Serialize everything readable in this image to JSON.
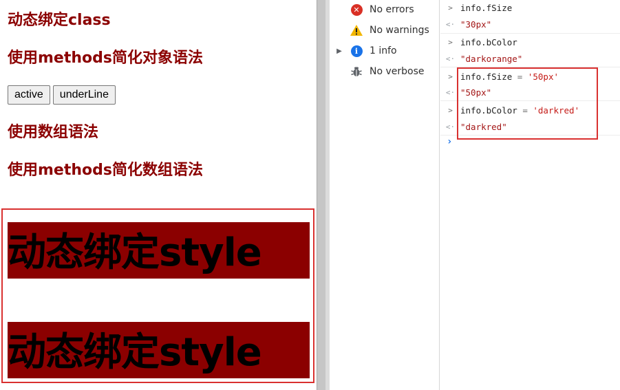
{
  "page": {
    "heading_class": "动态绑定class",
    "heading_methods_object": "使用methods简化对象语法",
    "buttons": {
      "active": "active",
      "underline": "underLine"
    },
    "heading_array": "使用数组语法",
    "heading_methods_array": "使用methods简化数组语法",
    "style_line_1": "动态绑定style",
    "style_line_2": "动态绑定style",
    "colors": {
      "heading": "#8b0000",
      "style_background": "#8b0000",
      "highlight_border": "#d9302f"
    }
  },
  "sidebar": {
    "errors": {
      "label": "No errors",
      "icon": "error-icon"
    },
    "warnings": {
      "label": "No warnings",
      "icon": "warning-icon"
    },
    "info": {
      "label": "1 info",
      "icon": "info-icon"
    },
    "verbose": {
      "label": "No verbose",
      "icon": "bug-icon"
    }
  },
  "console": {
    "entries": [
      {
        "input": "info.fSize",
        "result": "\"30px\""
      },
      {
        "input": "info.bColor",
        "result": "\"darkorange\""
      },
      {
        "input_obj": "info.fSize",
        "input_op": " = ",
        "input_str": "'50px'",
        "result": "\"50px\""
      },
      {
        "input_obj": "info.bColor",
        "input_op": " = ",
        "input_str": "'darkred'",
        "result": "\"darkred\""
      }
    ]
  }
}
